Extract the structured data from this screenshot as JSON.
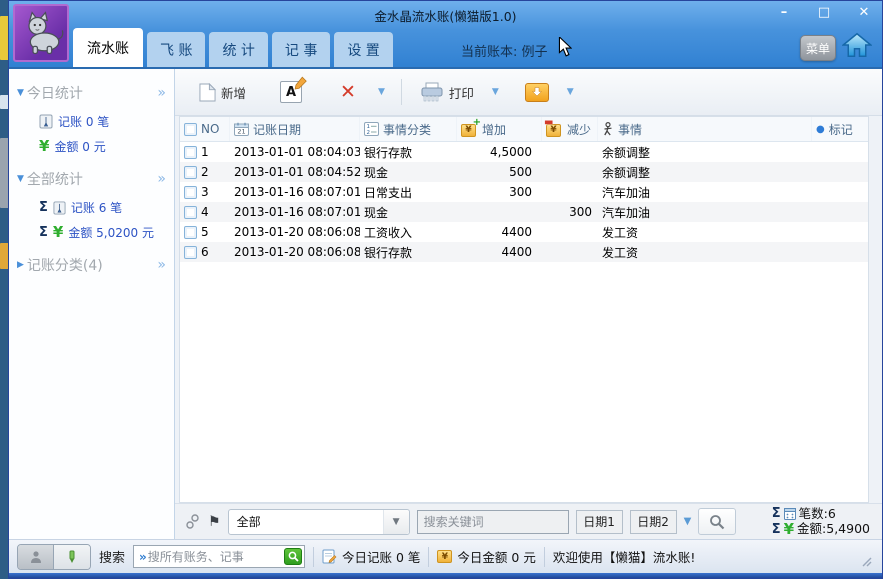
{
  "window": {
    "title": "金水晶流水账(懒猫版1.0)",
    "current_book": "当前账本: 例子",
    "menu_label": "菜单"
  },
  "icons": {
    "minimize": "–",
    "maximize": "□",
    "close": "✕",
    "delete_x": "✕",
    "dropdown_arrow": "▼",
    "expanded_triangle": "▼",
    "collapsed_triangle": "▶",
    "chevrons": "»",
    "sigma": "Σ",
    "yuan": "¥",
    "flag": "⚑",
    "dot": "●"
  },
  "colors": {
    "titlebar_blue": "#3a86d6",
    "accent_blue": "#2d53c4",
    "green": "#2fae2f",
    "orange": "#f2a21e",
    "red": "#d43b2a",
    "logo_purple": "#7b35b0"
  },
  "tabs": [
    {
      "label": "流水账",
      "active": true
    },
    {
      "label": "飞 账",
      "active": false
    },
    {
      "label": "统 计",
      "active": false
    },
    {
      "label": "记 事",
      "active": false
    },
    {
      "label": "设 置",
      "active": false
    }
  ],
  "sidebar": {
    "sections": [
      {
        "title": "今日统计",
        "expanded": true,
        "items": [
          {
            "icon": "pen-icon",
            "label": "记账 0 笔"
          },
          {
            "icon": "yuan-icon",
            "label": "金额 0 元"
          }
        ]
      },
      {
        "title": "全部统计",
        "expanded": true,
        "items": [
          {
            "icon": "sigma-pen-icon",
            "label": "记账 6 笔"
          },
          {
            "icon": "sigma-yuan-icon",
            "label": "金额 5,0200 元"
          }
        ]
      },
      {
        "title": "记账分类(4)",
        "expanded": false,
        "items": []
      }
    ]
  },
  "toolbar": {
    "new_label": "新增",
    "print_label": "打印"
  },
  "table": {
    "header": {
      "no": "NO",
      "date": "记账日期",
      "category": "事情分类",
      "increase": "增加",
      "decrease": "减少",
      "event": "事情",
      "mark": "标记"
    },
    "rows": [
      {
        "no": "1",
        "date": "2013-01-01 08:04:03",
        "category": "银行存款",
        "increase": "4,5000",
        "decrease": "",
        "event": "余额调整"
      },
      {
        "no": "2",
        "date": "2013-01-01 08:04:52",
        "category": "现金",
        "increase": "500",
        "decrease": "",
        "event": "余额调整"
      },
      {
        "no": "3",
        "date": "2013-01-16 08:07:01",
        "category": "日常支出",
        "increase": "300",
        "decrease": "",
        "event": "汽车加油"
      },
      {
        "no": "4",
        "date": "2013-01-16 08:07:01",
        "category": "现金",
        "increase": "",
        "decrease": "300",
        "event": "汽车加油"
      },
      {
        "no": "5",
        "date": "2013-01-20 08:06:08",
        "category": "工资收入",
        "increase": "4400",
        "decrease": "",
        "event": "发工资"
      },
      {
        "no": "6",
        "date": "2013-01-20 08:06:08",
        "category": "银行存款",
        "increase": "4400",
        "decrease": "",
        "event": "发工资"
      }
    ]
  },
  "filter_bar": {
    "scope_value": "全部",
    "keyword_placeholder": "搜索关键词",
    "date1_label": "日期1",
    "date2_label": "日期2",
    "count_stat": "笔数:6",
    "amount_stat": "金额:5,4900"
  },
  "status_bar": {
    "search_label": "搜索",
    "search_placeholder": "搜所有账务、记事",
    "today_entries": "今日记账 0 笔",
    "today_amount": "今日金额 0 元",
    "welcome": "欢迎使用【懒猫】流水账!"
  }
}
